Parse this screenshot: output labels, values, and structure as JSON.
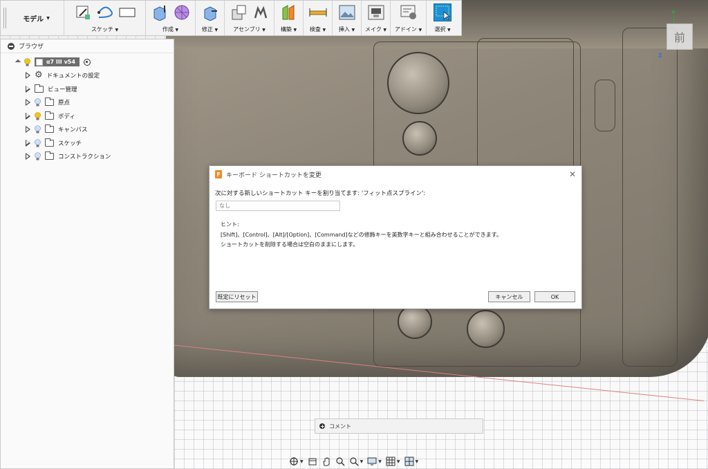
{
  "toolbar": {
    "workspace": "モデル",
    "groups": [
      {
        "label": "スケッチ"
      },
      {
        "label": "作成"
      },
      {
        "label": "修正"
      },
      {
        "label": "アセンブリ"
      },
      {
        "label": "構築"
      },
      {
        "label": "検査"
      },
      {
        "label": "挿入"
      },
      {
        "label": "メイク"
      },
      {
        "label": "アドイン"
      },
      {
        "label": "選択"
      }
    ],
    "dropdown_glyph": "▼"
  },
  "browser": {
    "title": "ブラウザ",
    "root": "α7 III v54",
    "items": [
      {
        "label": "ドキュメントの設定",
        "icon": "gear-icon"
      },
      {
        "label": "ビュー管理",
        "icon": "folder-icon"
      },
      {
        "label": "原点",
        "icon": "folder-icon",
        "bulb": "off"
      },
      {
        "label": "ボディ",
        "icon": "folder-icon",
        "bulb": "on"
      },
      {
        "label": "キャンバス",
        "icon": "folder-icon",
        "bulb": "off"
      },
      {
        "label": "スケッチ",
        "icon": "folder-icon",
        "bulb": "off"
      },
      {
        "label": "コンストラクション",
        "icon": "folder-icon",
        "bulb": "off"
      }
    ]
  },
  "viewcube": {
    "face": "前",
    "axis_y": "Y",
    "axis_z": "Z"
  },
  "dialog": {
    "title": "キーボード ショートカットを変更",
    "prompt": "次に対する新しいショートカット キーを割り当てます: 'フィット点スプライン':",
    "input_placeholder": "なし",
    "hint_title": "ヒント:",
    "hint_line1": "[Shift]、[Control]、[Alt]/[Option]、[Command]などの修飾キーを英数字キーと組み合わせることができます。",
    "hint_line2": "ショートカットを削除する場合は空白のままにします。",
    "reset_label": "既定にリセット",
    "cancel_label": "キャンセル",
    "ok_label": "OK",
    "close_glyph": "✕",
    "logo_letter": "F"
  },
  "comment": {
    "label": "コメント"
  },
  "colors": {
    "accent": "#1d8fd6",
    "logo": "#f08a24",
    "bulb_on": "#f5c518",
    "bulb_off": "#9fbfe8"
  }
}
